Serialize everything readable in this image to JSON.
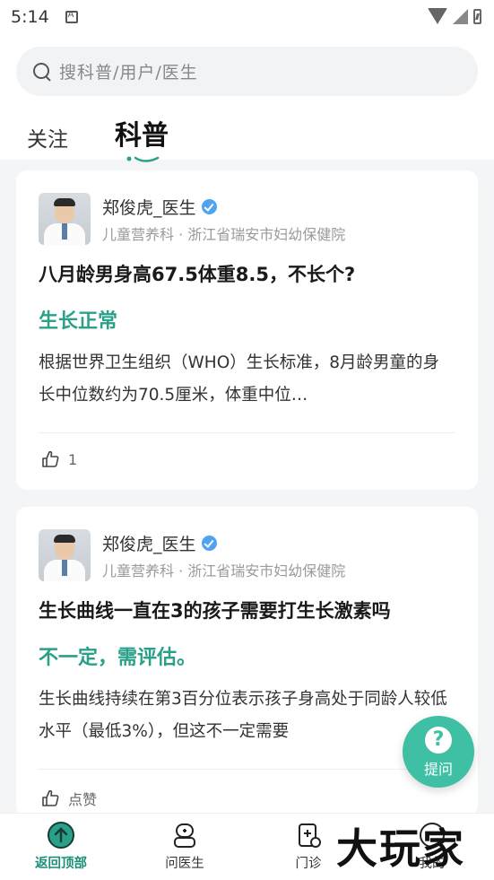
{
  "status_bar": {
    "time": "5:14"
  },
  "search": {
    "placeholder": "搜科普/用户/医生"
  },
  "tabs": [
    {
      "label": "关注",
      "active": false
    },
    {
      "label": "科普",
      "active": true
    }
  ],
  "posts": [
    {
      "doctor_name": "郑俊虎_医生",
      "doctor_meta": "儿童营养科 · 浙江省瑞安市妇幼保健院",
      "question": "八月龄男身高67.5体重8.5，不长个?",
      "answer_headline": "生长正常",
      "summary": "根据世界卫生组织（WHO）生长标准，8月龄男童的身长中位数约为70.5厘米，体重中位…",
      "like_label": "1"
    },
    {
      "doctor_name": "郑俊虎_医生",
      "doctor_meta": "儿童营养科 · 浙江省瑞安市妇幼保健院",
      "question": "生长曲线一直在3的孩子需要打生长激素吗",
      "answer_headline": "不一定，需评估。",
      "summary": "生长曲线持续在第3百分位表示孩子身高处于同龄人较低水平（最低3%），但这不一定需要",
      "like_label": "点赞"
    }
  ],
  "fab": {
    "label": "提问"
  },
  "bottom_nav": [
    {
      "label": "返回顶部",
      "active": true
    },
    {
      "label": "问医生",
      "active": false
    },
    {
      "label": "门诊",
      "active": false
    },
    {
      "label": "我的",
      "active": false
    }
  ],
  "watermark": "大玩家",
  "colors": {
    "accent": "#2aa089",
    "fab": "#3fbfa4",
    "verified": "#4fa3f0"
  }
}
